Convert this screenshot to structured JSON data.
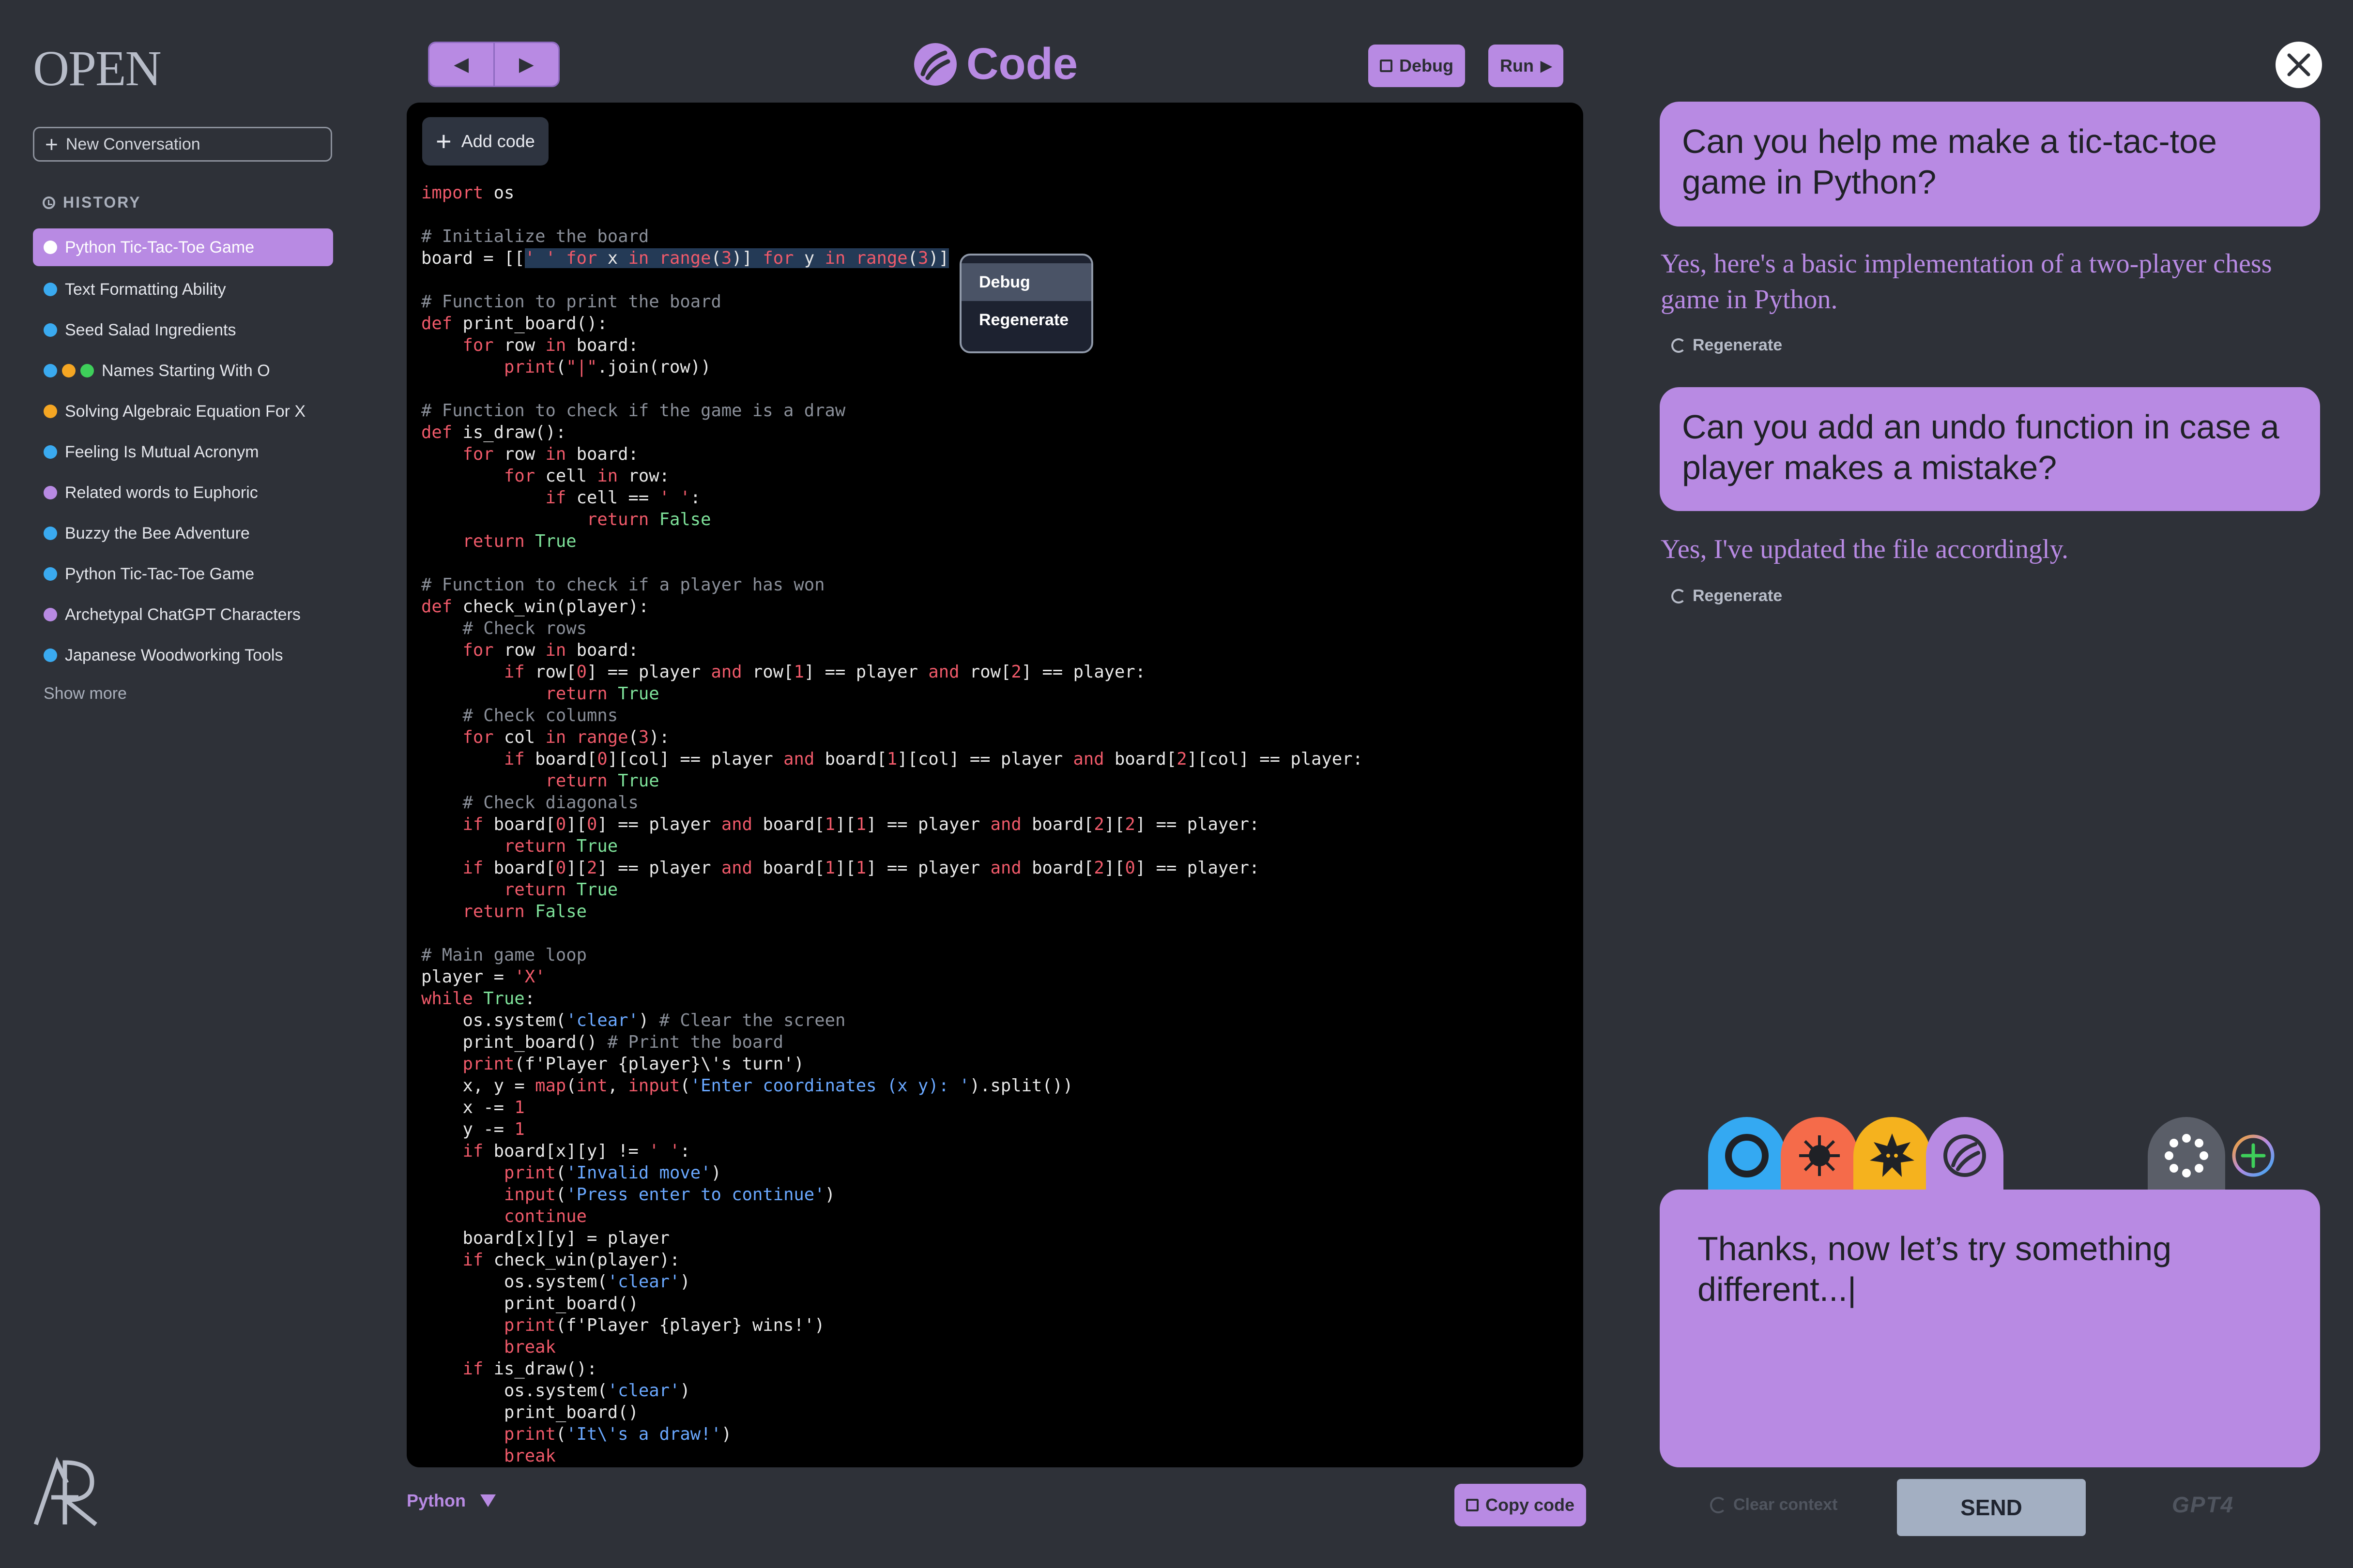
{
  "sidebar": {
    "logo": "OPEN",
    "new_conversation": "New Conversation",
    "history_title": "HISTORY",
    "items": [
      {
        "label": "Python Tic-Tac-Toe Game",
        "dots": [
          "#ffffff"
        ],
        "active": true
      },
      {
        "label": "Text Formatting Ability",
        "dots": [
          "#3aaaf0"
        ]
      },
      {
        "label": "Seed Salad Ingredients",
        "dots": [
          "#3aaaf0"
        ]
      },
      {
        "label": "Names Starting With O",
        "dots": [
          "#3aaaf0",
          "#f5a623",
          "#3ecf5a"
        ]
      },
      {
        "label": "Solving Algebraic Equation For X",
        "dots": [
          "#f5a623"
        ]
      },
      {
        "label": "Feeling Is Mutual Acronym",
        "dots": [
          "#3aaaf0"
        ]
      },
      {
        "label": "Related words to Euphoric",
        "dots": [
          "#b88ae3"
        ]
      },
      {
        "label": "Buzzy the Bee Adventure",
        "dots": [
          "#3aaaf0"
        ]
      },
      {
        "label": "Python Tic-Tac-Toe Game",
        "dots": [
          "#3aaaf0"
        ]
      },
      {
        "label": "Archetypal ChatGPT Characters",
        "dots": [
          "#b88ae3"
        ]
      },
      {
        "label": "Japanese Woodworking Tools",
        "dots": [
          "#3aaaf0"
        ]
      }
    ],
    "show_more": "Show more"
  },
  "toolbar": {
    "title": "Code",
    "debug": "Debug",
    "run": "Run",
    "accent": "#b88ae3"
  },
  "editor": {
    "add_code": "Add code",
    "language": "Python",
    "copy_code": "Copy code",
    "context_menu": [
      "Debug",
      "Regenerate"
    ]
  },
  "chat": {
    "messages": [
      {
        "role": "user",
        "text": "Can you help me make a tic-tac-toe game in Python?"
      },
      {
        "role": "assistant",
        "text": "Yes, here's a basic implementation of a two-player chess game in Python.",
        "action": "Regenerate"
      },
      {
        "role": "user",
        "text": "Can you add an undo function in case a player makes a mistake?"
      },
      {
        "role": "assistant",
        "text": "Yes, I've updated the file accordingly.",
        "action": "Regenerate"
      }
    ],
    "input_text": "Thanks, now let’s try something different...|",
    "clear_context": "Clear context",
    "send": "SEND",
    "brand": "GPT4",
    "model_colors": [
      "#34a9f2",
      "#f56b4a",
      "#f5b21e",
      "#b88ae3"
    ],
    "extra_colors": [
      "#5a5e68"
    ]
  }
}
